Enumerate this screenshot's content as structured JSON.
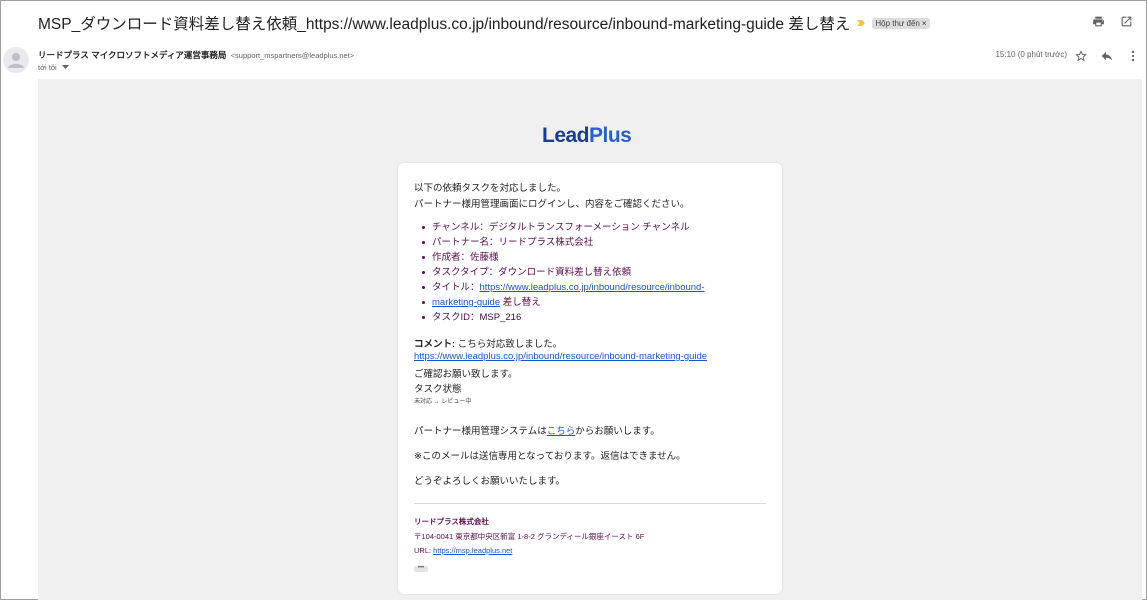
{
  "email": {
    "subject": "MSP_ダウンロード資料差し替え依頼_https://www.leadplus.co.jp/inbound/resource/inbound-marketing-guide 差し替え",
    "label": "Hộp thư đến",
    "label_close": "×",
    "sender_name": "リードプラス マイクロソフトメディア運営事務局",
    "sender_email": "<support_mspartners@leadplus.net>",
    "to": "tới tôi",
    "time": "15:10 (0 phút trước)"
  },
  "body": {
    "logo_lead": "Lead",
    "logo_plus": "Plus",
    "intro1": "以下の依頼タスクを対応しました。",
    "intro2": "パートナー様用管理画面にログインし、内容をご確認ください。",
    "bullets": {
      "channel": "チャンネル：デジタルトランスフォーメーション チャンネル",
      "partner": "パートナー名：リードプラス株式会社",
      "creator": "作成者：佐藤様",
      "task_type": "タスクタイプ：ダウンロード資料差し替え依頼",
      "title_prefix": "タイトル：",
      "title_link_1": "https://www.leadplus.co.jp/inbound/resource/inbound-",
      "title_link_2": "marketing-guide",
      "title_suffix": " 差し替え",
      "task_id_label": "タスクID：",
      "task_id": "MSP_216"
    },
    "comment_label": "コメント:",
    "comment_text": " こちら対応致しました。",
    "comment_link": "https://www.leadplus.co.jp/inbound/resource/inbound-marketing-guide",
    "confirm": "ご確認お願い致します。",
    "task_status_label": "タスク状態",
    "task_status": "未対応 → レビュー中",
    "system_prefix": "パートナー様用管理システムは",
    "system_link": "こちら",
    "system_suffix": "からお願いします。",
    "notice": "※このメールは送信専用となっております。返信はできません。",
    "closing": "どうぞよろしくお願いいたします。"
  },
  "signature": {
    "company": "リードプラス株式会社",
    "address": "〒104-0041 東京都中央区新富 1-8-2 グランディール銀座イースト 6F",
    "url_label": "URL: ",
    "url": "https://msp.leadplus.net",
    "more": "•••"
  },
  "icons": {
    "print": "print-icon",
    "open_new": "open-in-new-window-icon",
    "star": "star-icon",
    "reply": "reply-icon",
    "more": "more-vert-icon",
    "avatar": "person-avatar-icon",
    "importance": "importance-marker-icon"
  }
}
